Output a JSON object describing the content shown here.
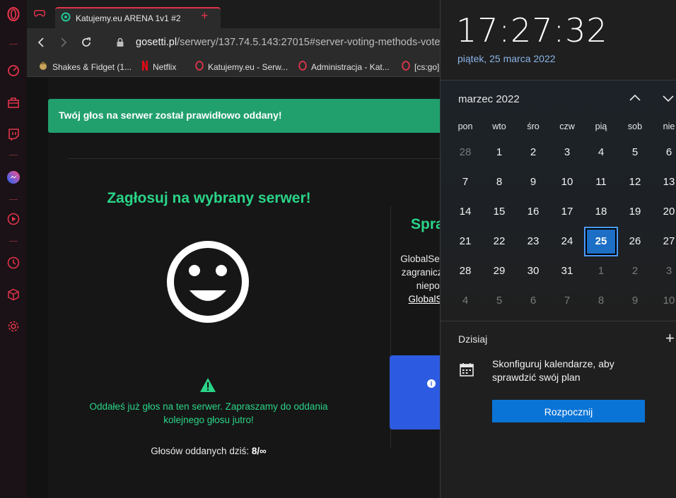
{
  "browser": {
    "tab_title": "Katujemy.eu ARENA 1v1 #2",
    "new_tab_label": "+",
    "url_host": "gosetti.pl",
    "url_path": "/serwery/137.74.5.143:27015#server-voting-methods-votes",
    "bookmarks": [
      {
        "label": "Shakes & Fidget (1..."
      },
      {
        "label": "Netflix"
      },
      {
        "label": "Katujemy.eu - Serw..."
      },
      {
        "label": "Administracja - Kat..."
      },
      {
        "label": "[cs:go]"
      }
    ]
  },
  "sidebar": {
    "items": [
      "opera-logo-icon",
      "speed-dial-icon",
      "bag-icon",
      "twitch-icon",
      "messenger-icon",
      "player-icon",
      "history-icon",
      "extensions-icon",
      "settings-icon"
    ]
  },
  "page": {
    "alert": "Twój głos na serwer został prawidłowo oddany!",
    "vote_heading": "Zagłosuj na wybrany serwer!",
    "already_voted": "Oddałeś już głos na ten serwer. Zapraszamy do oddania kolejnego głosu jutro!",
    "votes_today_label": "Głosów oddanych dziś:",
    "votes_today_value": "8/∞",
    "right_title": "Spra",
    "right_lines": [
      "GlobalServ",
      "zagraniczn",
      "nieporz"
    ],
    "right_link": "GlobalSe",
    "info_glyph": "i",
    "accent": "#2ad488",
    "alert_color": "#21a06e"
  },
  "flyout": {
    "time": "17:27:32",
    "date": "piątek, 25 marca 2022",
    "month": "marzec 2022",
    "weekdays": [
      "pon",
      "wto",
      "śro",
      "czw",
      "pią",
      "sob",
      "nie"
    ],
    "weeks": [
      [
        "28",
        "1",
        "2",
        "3",
        "4",
        "5",
        "6"
      ],
      [
        "7",
        "8",
        "9",
        "10",
        "11",
        "12",
        "13"
      ],
      [
        "14",
        "15",
        "16",
        "17",
        "18",
        "19",
        "20"
      ],
      [
        "21",
        "22",
        "23",
        "24",
        "25",
        "26",
        "27"
      ],
      [
        "28",
        "29",
        "30",
        "31",
        "1",
        "2",
        "3"
      ],
      [
        "4",
        "5",
        "6",
        "7",
        "8",
        "9",
        "10"
      ]
    ],
    "today": "25",
    "today_label": "Dzisiaj",
    "add_label": "+",
    "config_text": "Skonfiguruj kalendarze, aby sprawdzić swój plan",
    "start_button": "Rozpocznij",
    "today_color": "#1d6ec5"
  }
}
